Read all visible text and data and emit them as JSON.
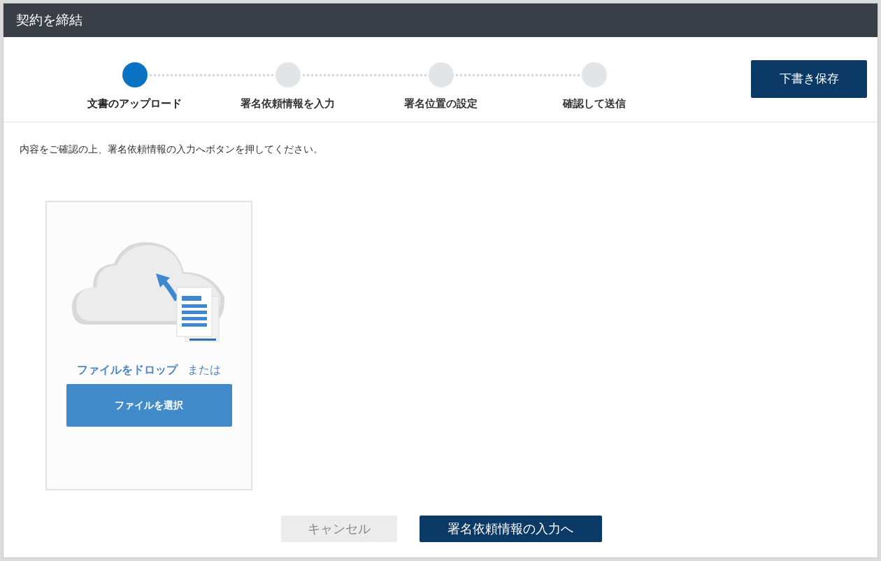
{
  "window": {
    "title": "契約を締結"
  },
  "steps": [
    {
      "label": "文書のアップロード",
      "selected": true
    },
    {
      "label": "署名依頼情報を入力",
      "selected": false
    },
    {
      "label": "署名位置の設定",
      "selected": false
    },
    {
      "label": "確認して送信",
      "selected": false
    }
  ],
  "save_button": "下書き保存",
  "instruction": "内容をご確認の上、署名依頼情報の入力へボタンを押してください。",
  "dropzone": {
    "drop_text": "ファイルをドロップ",
    "or_text": "または",
    "select_button": "ファイルを選択"
  },
  "footer_buttons": [
    {
      "label": "キャンセル",
      "kind": "secondary"
    },
    {
      "label": "署名依頼情報の入力へ",
      "kind": "primary"
    }
  ]
}
